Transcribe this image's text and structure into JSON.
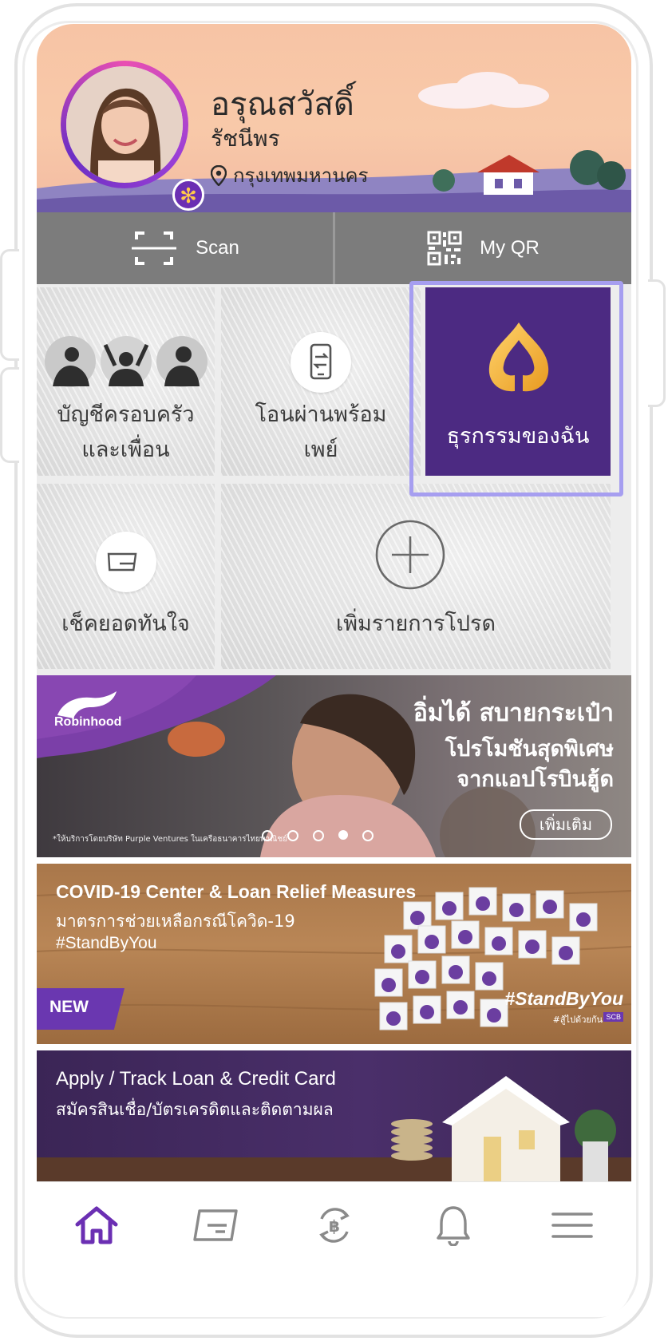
{
  "header": {
    "greeting": "อรุณสวัสดิ์",
    "user_name": "รัชนีพร",
    "location": "กรุงเทพมหานคร",
    "location_icon": "map-pin-icon"
  },
  "quick_actions": {
    "scan_label": "Scan",
    "myqr_label": "My QR"
  },
  "tiles": {
    "family_line1": "บัญชีครอบครัว",
    "family_line2": "และเพื่อน",
    "promptpay_line1": "โอนผ่านพร้อม",
    "promptpay_line2": "เพย์",
    "my_transactions": "ธุรกรรมของฉัน",
    "check_balance": "เช็คยอดทันใจ",
    "add_favorite": "เพิ่มรายการโปรด"
  },
  "banners": {
    "robinhood": {
      "brand": "Robinhood",
      "headline": "อิ่มได้ สบายกระเป๋า",
      "line2": "โปรโมชันสุดพิเศษ",
      "line3": "จากแอปโรบินฮู้ด",
      "more_button": "เพิ่มเติม",
      "disclaimer": "*ให้บริการโดยบริษัท Purple Ventures ในเครือธนาคารไทยพาณิชย์",
      "carousel_dots": 5,
      "carousel_active": 4
    },
    "covid": {
      "title": "COVID-19 Center & Loan Relief Measures",
      "subtitle": "มาตรการช่วยเหลือกรณีโควิด-19",
      "hashtag": "#StandByYou",
      "badge": "NEW",
      "overlay_hashtag": "#StandByYou",
      "overlay_sub": "#สู้ไปด้วยกัน",
      "overlay_logo": "SCB"
    },
    "loan": {
      "title": "Apply / Track Loan & Credit Card",
      "subtitle": "สมัครสินเชื่อ/บัตรเครดิตและติดตามผล"
    }
  },
  "bottom_nav": [
    {
      "icon": "home-icon",
      "active": true
    },
    {
      "icon": "card-icon",
      "active": false
    },
    {
      "icon": "baht-transfer-icon",
      "active": false
    },
    {
      "icon": "bell-icon",
      "active": false
    },
    {
      "icon": "menu-icon",
      "active": false
    }
  ],
  "colors": {
    "brand_purple": "#4c2a82",
    "accent_gold": "#f4b43a",
    "nav_active": "#6b2fb3",
    "highlight": "#a69ef0"
  }
}
